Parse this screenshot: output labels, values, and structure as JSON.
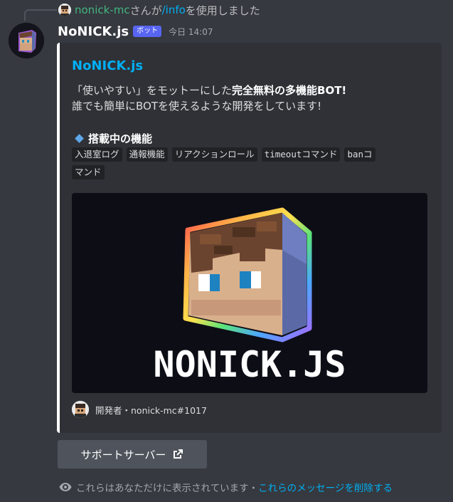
{
  "reply": {
    "username": "nonick-mc",
    "text_middle": "さんが",
    "command": "/info",
    "text_end": "を使用しました"
  },
  "message": {
    "author": "NoNICK.js",
    "bot_tag": "ボット",
    "timestamp": "今日 14:07"
  },
  "embed": {
    "title": "NoNICK.js",
    "desc_line1_a": "「使いやすい」をモットーにした",
    "desc_line1_b": "完全無料の多機能BOT!",
    "desc_line2": "誰でも簡単にBOTを使えるような開発をしています!",
    "field_name": "搭載中の機能",
    "features": [
      "入退室ログ",
      "通報機能",
      "リアクションロール",
      "timeoutコマンド",
      "banコ",
      "マンド"
    ],
    "image_logo_text": "NONICK.JS",
    "footer_text": "開発者・nonick-mc#1017"
  },
  "button": {
    "label": "サポートサーバー"
  },
  "notice": {
    "text": "これらはあなただけに表示されています・",
    "link": "これらのメッセージを削除する"
  },
  "colors": {
    "background": "#36393f",
    "embed_bg": "#2f3136",
    "embed_border": "#ffffff",
    "link": "#00aff4",
    "username_reply": "#43b581",
    "bot_tag": "#5865f2",
    "button": "#4f545c"
  },
  "icons": [
    "avatar-icon",
    "external-link-icon",
    "eye-icon",
    "diamond-icon"
  ]
}
